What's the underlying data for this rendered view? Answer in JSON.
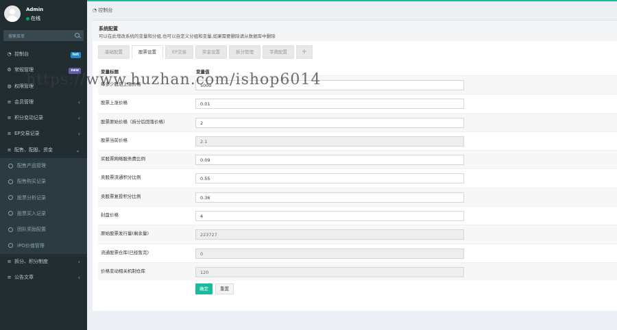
{
  "user": {
    "name": "Admin",
    "status": "在线"
  },
  "search": {
    "placeholder": "搜索菜单"
  },
  "menu": [
    {
      "label": "控制台",
      "icon": "dashboard-icon",
      "badge": "hot"
    },
    {
      "label": "常规管理",
      "icon": "gear-icon",
      "badge": "new"
    },
    {
      "label": "权限管理",
      "icon": "group-icon"
    },
    {
      "label": "会员管理",
      "icon": "list-icon"
    },
    {
      "label": "积分变动记录",
      "icon": "list-icon"
    },
    {
      "label": "EP交易记录",
      "icon": "list-icon"
    },
    {
      "label": "配售、配股、资金",
      "icon": "list-icon"
    }
  ],
  "submenu": [
    {
      "label": "配售产品管理"
    },
    {
      "label": "配售购买记录"
    },
    {
      "label": "股票分析记录"
    },
    {
      "label": "股票买入记录"
    },
    {
      "label": "团队奖励配置"
    },
    {
      "label": "IPO价值管理"
    }
  ],
  "menu_after": [
    {
      "label": "拆分、积分制度",
      "icon": "list-icon"
    },
    {
      "label": "公告文章",
      "icon": "list-icon"
    }
  ],
  "breadcrumb": {
    "label": "控制台"
  },
  "panel": {
    "title": "系统配置",
    "desc": "可以在此增改系统的变量和分组,也可以自定义分组和变量,如果需要删除请从数据库中删除"
  },
  "tabs": [
    {
      "label": "基础配置",
      "active": false
    },
    {
      "label": "股票设置",
      "active": true
    },
    {
      "label": "EP交易",
      "active": false
    },
    {
      "label": "奖金设置",
      "active": false
    },
    {
      "label": "拆分管理",
      "active": false
    },
    {
      "label": "字典配置",
      "active": false
    },
    {
      "label": "+",
      "active": false
    }
  ],
  "table": {
    "headers": [
      "变量标题",
      "变量值"
    ],
    "rows": [
      {
        "label": "每多少股后上涨价格",
        "value": "5000",
        "readonly": false
      },
      {
        "label": "股票上涨价格",
        "value": "0.01",
        "readonly": false
      },
      {
        "label": "股票原始价格（拆分后回落价格）",
        "value": "2",
        "readonly": false
      },
      {
        "label": "股票当前价格",
        "value": "2.1",
        "readonly": true
      },
      {
        "label": "买股票网络服务费比例",
        "value": "0.09",
        "readonly": false
      },
      {
        "label": "卖股票流通积分比例",
        "value": "0.55",
        "readonly": false
      },
      {
        "label": "卖股票复投积分比例",
        "value": "0.36",
        "readonly": false
      },
      {
        "label": "封盘价格",
        "value": "4",
        "readonly": false
      },
      {
        "label": "原始股票发行量(剩余量)",
        "value": "223727",
        "readonly": true
      },
      {
        "label": "流通股票仓库(已经售完)",
        "value": "0",
        "readonly": true
      },
      {
        "label": "价格变动相关机制仓库",
        "value": "120",
        "readonly": true
      }
    ]
  },
  "buttons": {
    "save": "确定",
    "reset": "重置"
  },
  "watermark": "https://www.huzhan.com/ishop6014"
}
